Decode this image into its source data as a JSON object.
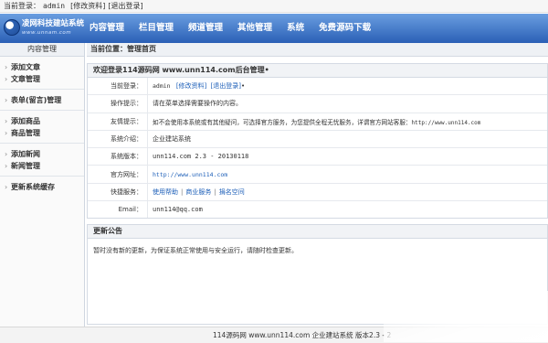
{
  "topbar": {
    "label": "当前登录：",
    "user": "admin",
    "edit_profile": "[修改资料]",
    "logout": "[退出登录]"
  },
  "logo": {
    "title": "凌网科技建站系统",
    "subtitle": "www.unnam.com"
  },
  "nav": [
    "内容管理",
    "栏目管理",
    "频道管理",
    "其他管理",
    "系统",
    "免费源码下载"
  ],
  "sidebar": {
    "title": "内容管理",
    "groups": [
      [
        "添加文章",
        "文章管理"
      ],
      [
        "表单(留言)管理"
      ],
      [
        "添加商品",
        "商品管理"
      ],
      [
        "添加新闻",
        "新闻管理"
      ],
      [
        "更新系统缓存"
      ]
    ]
  },
  "breadcrumb": "当前位置：管理首页",
  "welcome": {
    "title": "欢迎登录114源码网 www.unn114.com后台管理•",
    "rows": {
      "current_login": {
        "label": "当前登录：",
        "user": "admin",
        "edit": "[修改资料]",
        "logout": "[退出登录]",
        "tail": "•"
      },
      "tip": {
        "label": "操作提示：",
        "value": "请在菜单选择需要操作的内容。"
      },
      "friendly": {
        "label": "友情提示：",
        "value": "如不会使用本系统或有其他疑问，可选择官方服务，为您提供全程无忧服务，详谓官方网站客服：",
        "url": "http://www.unn114.com"
      },
      "intro": {
        "label": "系统介绍：",
        "value": "企业建站系统"
      },
      "version": {
        "label": "系统版本：",
        "value": "unn114.com 2.3 - 20130118"
      },
      "site": {
        "label": "官方网址：",
        "value": "http://www.unn114.com"
      },
      "quick": {
        "label": "快捷服务：",
        "links": [
          "使用帮助",
          "商业服务",
          "捐名空间"
        ],
        "sep": "|"
      },
      "email": {
        "label": "Email：",
        "value": "unn114@qq.com"
      }
    }
  },
  "update": {
    "title": "更新公告",
    "text": "暂时没有新的更新，为保证系统正常使用与安全运行，请随时检查更新。"
  },
  "footer": "114源码网 www.unn114.com  企业建站系统  版本2.3 - 2"
}
